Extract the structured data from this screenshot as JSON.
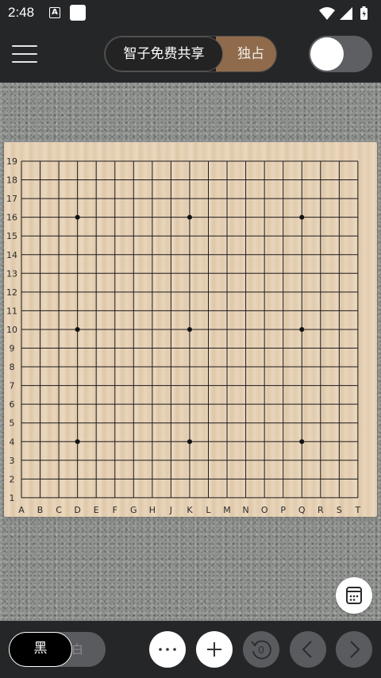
{
  "status_bar": {
    "time": "2:48",
    "notif_icon_a": "A",
    "icons": [
      "notification-a-icon",
      "app-square-icon",
      "wifi-icon",
      "signal-icon",
      "battery-icon"
    ]
  },
  "header": {
    "menu_icon": "hamburger-menu-icon",
    "segment": {
      "left_label": "智子免费共享",
      "right_label": "独占"
    },
    "toggle": {
      "state": "off"
    }
  },
  "board": {
    "size": 19,
    "columns": [
      "A",
      "B",
      "C",
      "D",
      "E",
      "F",
      "G",
      "H",
      "J",
      "K",
      "L",
      "M",
      "N",
      "O",
      "P",
      "Q",
      "R",
      "S",
      "T"
    ],
    "rows": [
      "19",
      "18",
      "17",
      "16",
      "15",
      "14",
      "13",
      "12",
      "11",
      "10",
      "9",
      "8",
      "7",
      "6",
      "5",
      "4",
      "3",
      "2",
      "1"
    ],
    "star_points": [
      "D16",
      "K16",
      "Q16",
      "D10",
      "K10",
      "Q10",
      "D4",
      "K4",
      "Q4"
    ],
    "stones": []
  },
  "bottom_bar": {
    "black_label": "黑",
    "white_label": "白",
    "buttons": [
      "more-icon",
      "add-icon",
      "undo-count-icon",
      "previous-icon",
      "next-icon"
    ],
    "undo_count": "0"
  },
  "fab_icon": "calendar-grid-icon",
  "colors": {
    "bar_bg": "#252628",
    "accent_brown": "#8f6a4b",
    "board_wood": "#e3cdb0"
  }
}
